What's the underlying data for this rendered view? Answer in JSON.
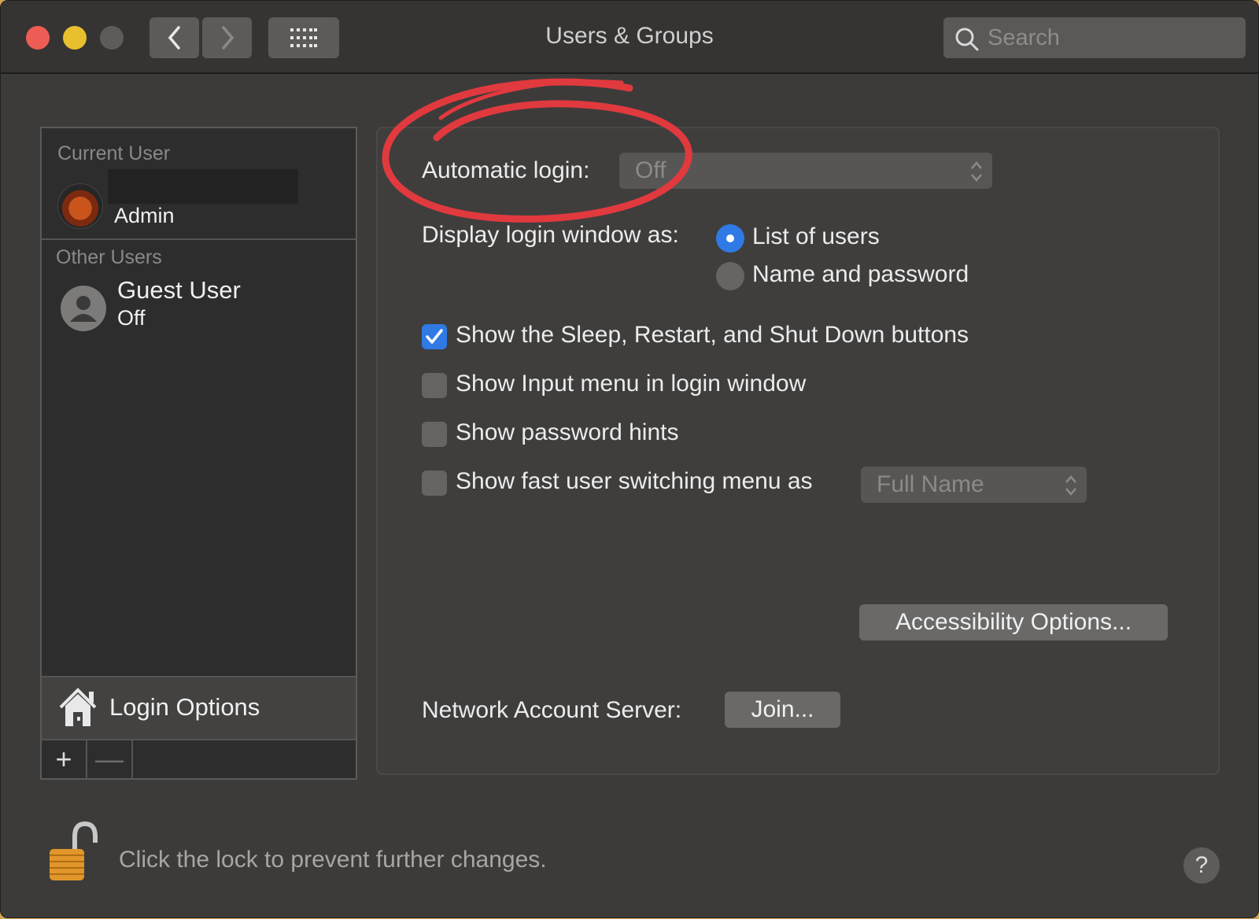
{
  "window": {
    "title": "Users & Groups"
  },
  "search": {
    "placeholder": "Search"
  },
  "sidebar": {
    "current_user_label": "Current User",
    "current_user_role": "Admin",
    "other_users_label": "Other Users",
    "guest_name": "Guest User",
    "guest_status": "Off",
    "login_options_label": "Login Options",
    "add_label": "+",
    "remove_label": "—"
  },
  "login": {
    "automatic_login_label": "Automatic login:",
    "automatic_login_value": "Off",
    "display_as_label": "Display login window as:",
    "radio_list_label": "List of users",
    "radio_name_label": "Name and password",
    "radio_selected": "List of users",
    "checkboxes": [
      {
        "label": "Show the Sleep, Restart, and Shut Down buttons",
        "checked": true
      },
      {
        "label": "Show Input menu in login window",
        "checked": false
      },
      {
        "label": "Show password hints",
        "checked": false
      },
      {
        "label": "Show fast user switching menu as",
        "checked": false
      }
    ],
    "fast_switch_value": "Full Name",
    "accessibility_button": "Accessibility Options...",
    "network_label": "Network Account Server:",
    "join_button": "Join..."
  },
  "footer": {
    "lock_text": "Click the lock to prevent further changes.",
    "help_label": "?"
  },
  "colors": {
    "accent": "#2f7ae5",
    "annotation": "#e0393e",
    "window_bg": "#3c3b3a"
  }
}
